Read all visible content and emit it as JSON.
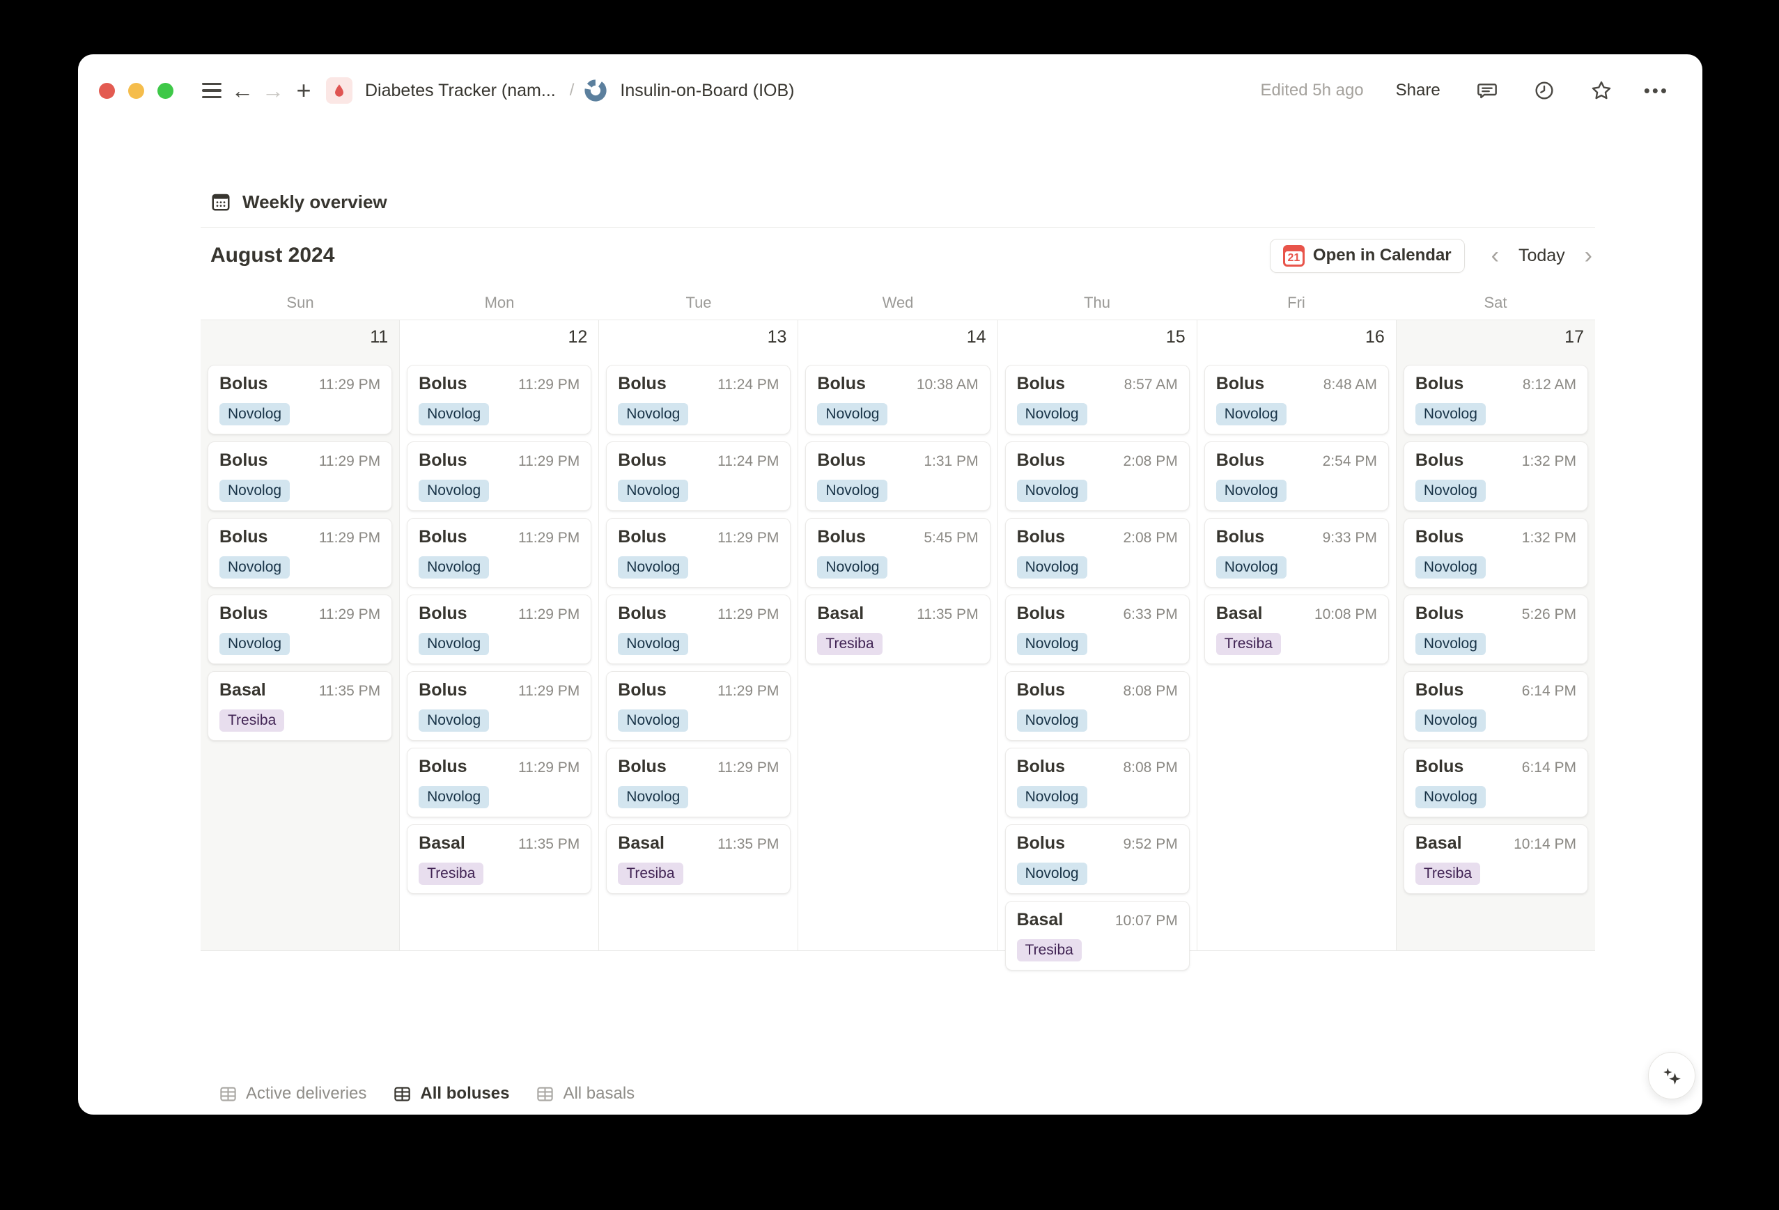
{
  "topbar": {
    "breadcrumb_primary": "Diabetes Tracker (nam...",
    "breadcrumb_separator": "/",
    "breadcrumb_secondary": "Insulin-on-Board (IOB)",
    "edited_label": "Edited 5h ago",
    "share_label": "Share"
  },
  "view_header": {
    "title": "Weekly overview"
  },
  "month_bar": {
    "month_label": "August 2024",
    "open_in_calendar_label": "Open in Calendar",
    "calendar_badge_day": "21",
    "today_label": "Today"
  },
  "icons": {
    "back": "←",
    "forward": "→",
    "new_page": "+",
    "more": "•••",
    "chevron_left": "‹",
    "chevron_right": "›"
  },
  "calendar": {
    "days": [
      {
        "dow": "Sun",
        "date": 11,
        "weekend": true,
        "events": [
          {
            "title": "Bolus",
            "time": "11:29 PM",
            "tag": "Novolog"
          },
          {
            "title": "Bolus",
            "time": "11:29 PM",
            "tag": "Novolog"
          },
          {
            "title": "Bolus",
            "time": "11:29 PM",
            "tag": "Novolog"
          },
          {
            "title": "Bolus",
            "time": "11:29 PM",
            "tag": "Novolog"
          },
          {
            "title": "Basal",
            "time": "11:35 PM",
            "tag": "Tresiba"
          }
        ]
      },
      {
        "dow": "Mon",
        "date": 12,
        "weekend": false,
        "events": [
          {
            "title": "Bolus",
            "time": "11:29 PM",
            "tag": "Novolog"
          },
          {
            "title": "Bolus",
            "time": "11:29 PM",
            "tag": "Novolog"
          },
          {
            "title": "Bolus",
            "time": "11:29 PM",
            "tag": "Novolog"
          },
          {
            "title": "Bolus",
            "time": "11:29 PM",
            "tag": "Novolog"
          },
          {
            "title": "Bolus",
            "time": "11:29 PM",
            "tag": "Novolog"
          },
          {
            "title": "Bolus",
            "time": "11:29 PM",
            "tag": "Novolog"
          },
          {
            "title": "Basal",
            "time": "11:35 PM",
            "tag": "Tresiba"
          }
        ]
      },
      {
        "dow": "Tue",
        "date": 13,
        "weekend": false,
        "events": [
          {
            "title": "Bolus",
            "time": "11:24 PM",
            "tag": "Novolog"
          },
          {
            "title": "Bolus",
            "time": "11:24 PM",
            "tag": "Novolog"
          },
          {
            "title": "Bolus",
            "time": "11:29 PM",
            "tag": "Novolog"
          },
          {
            "title": "Bolus",
            "time": "11:29 PM",
            "tag": "Novolog"
          },
          {
            "title": "Bolus",
            "time": "11:29 PM",
            "tag": "Novolog"
          },
          {
            "title": "Bolus",
            "time": "11:29 PM",
            "tag": "Novolog"
          },
          {
            "title": "Basal",
            "time": "11:35 PM",
            "tag": "Tresiba"
          }
        ]
      },
      {
        "dow": "Wed",
        "date": 14,
        "weekend": false,
        "events": [
          {
            "title": "Bolus",
            "time": "10:38 AM",
            "tag": "Novolog"
          },
          {
            "title": "Bolus",
            "time": "1:31 PM",
            "tag": "Novolog"
          },
          {
            "title": "Bolus",
            "time": "5:45 PM",
            "tag": "Novolog"
          },
          {
            "title": "Basal",
            "time": "11:35 PM",
            "tag": "Tresiba"
          }
        ]
      },
      {
        "dow": "Thu",
        "date": 15,
        "weekend": false,
        "events": [
          {
            "title": "Bolus",
            "time": "8:57 AM",
            "tag": "Novolog"
          },
          {
            "title": "Bolus",
            "time": "2:08 PM",
            "tag": "Novolog"
          },
          {
            "title": "Bolus",
            "time": "2:08 PM",
            "tag": "Novolog"
          },
          {
            "title": "Bolus",
            "time": "6:33 PM",
            "tag": "Novolog"
          },
          {
            "title": "Bolus",
            "time": "8:08 PM",
            "tag": "Novolog"
          },
          {
            "title": "Bolus",
            "time": "8:08 PM",
            "tag": "Novolog"
          },
          {
            "title": "Bolus",
            "time": "9:52 PM",
            "tag": "Novolog"
          },
          {
            "title": "Basal",
            "time": "10:07 PM",
            "tag": "Tresiba"
          }
        ]
      },
      {
        "dow": "Fri",
        "date": 16,
        "weekend": false,
        "events": [
          {
            "title": "Bolus",
            "time": "8:48 AM",
            "tag": "Novolog"
          },
          {
            "title": "Bolus",
            "time": "2:54 PM",
            "tag": "Novolog"
          },
          {
            "title": "Bolus",
            "time": "9:33 PM",
            "tag": "Novolog"
          },
          {
            "title": "Basal",
            "time": "10:08 PM",
            "tag": "Tresiba"
          }
        ]
      },
      {
        "dow": "Sat",
        "date": 17,
        "weekend": true,
        "events": [
          {
            "title": "Bolus",
            "time": "8:12 AM",
            "tag": "Novolog"
          },
          {
            "title": "Bolus",
            "time": "1:32 PM",
            "tag": "Novolog"
          },
          {
            "title": "Bolus",
            "time": "1:32 PM",
            "tag": "Novolog"
          },
          {
            "title": "Bolus",
            "time": "5:26 PM",
            "tag": "Novolog"
          },
          {
            "title": "Bolus",
            "time": "6:14 PM",
            "tag": "Novolog"
          },
          {
            "title": "Bolus",
            "time": "6:14 PM",
            "tag": "Novolog"
          },
          {
            "title": "Basal",
            "time": "10:14 PM",
            "tag": "Tresiba"
          }
        ]
      }
    ]
  },
  "tabs": [
    {
      "label": "Active deliveries",
      "active": false
    },
    {
      "label": "All boluses",
      "active": true
    },
    {
      "label": "All basals",
      "active": false
    }
  ],
  "colors": {
    "accent_red": "#e8544a",
    "text_primary": "#37352f",
    "text_muted": "#9b9a97",
    "weekend_bg": "#f7f7f5",
    "tags": {
      "Novolog": {
        "bg": "#d3e5ef",
        "fg": "#183347"
      },
      "Tresiba": {
        "bg": "#e8deee",
        "fg": "#412454"
      }
    }
  }
}
